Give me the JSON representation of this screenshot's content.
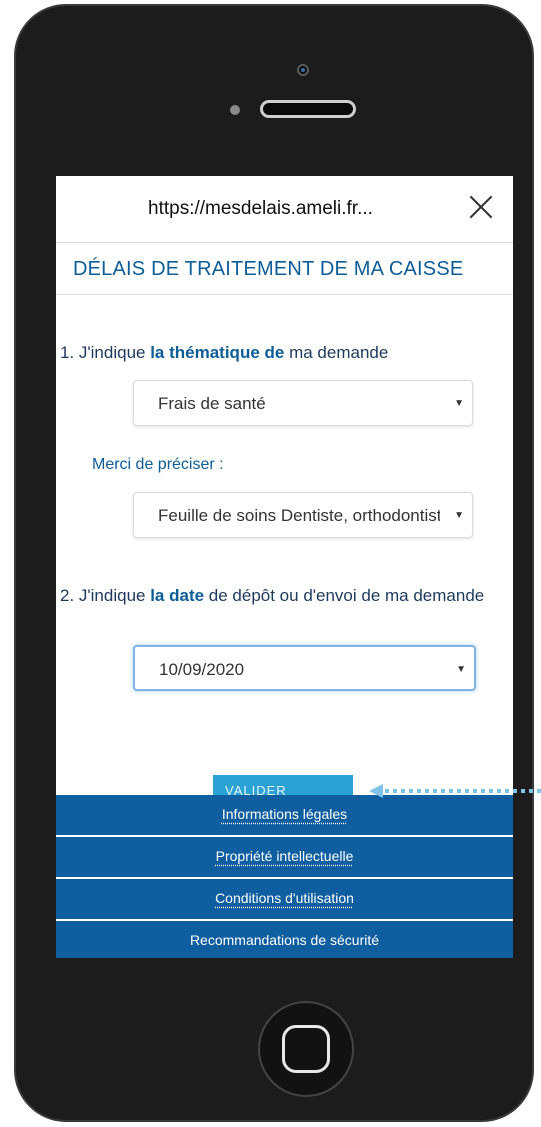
{
  "browser": {
    "url": "https://mesdelais.ameli.fr...",
    "close_icon": "close-icon"
  },
  "page": {
    "title": "DÉLAIS DE TRAITEMENT DE MA CAISSE"
  },
  "form": {
    "question1": {
      "prefix": "1. J'indique ",
      "bold": "la thématique",
      "middle": " de",
      "suffix": " ma demande"
    },
    "theme_select": {
      "value": "Frais de santé"
    },
    "precision_label": "Merci de préciser :",
    "precision_select": {
      "value": "Feuille de soins Dentiste, orthodontiste"
    },
    "question2": {
      "prefix": "2. J'indique ",
      "bold": "la date",
      "suffix": " de dépôt ou d'envoi de ma demande"
    },
    "date_select": {
      "value": "10/09/2020"
    },
    "submit_label": "VALIDER"
  },
  "footer": {
    "links": [
      "Informations légales",
      "Propriété intellectuelle",
      "Conditions d'utilisation",
      "Recommandations de sécurité"
    ]
  },
  "colors": {
    "brand_blue": "#0e5ea0",
    "accent_blue": "#2aa2d4",
    "pointer": "#7fc3e8"
  }
}
